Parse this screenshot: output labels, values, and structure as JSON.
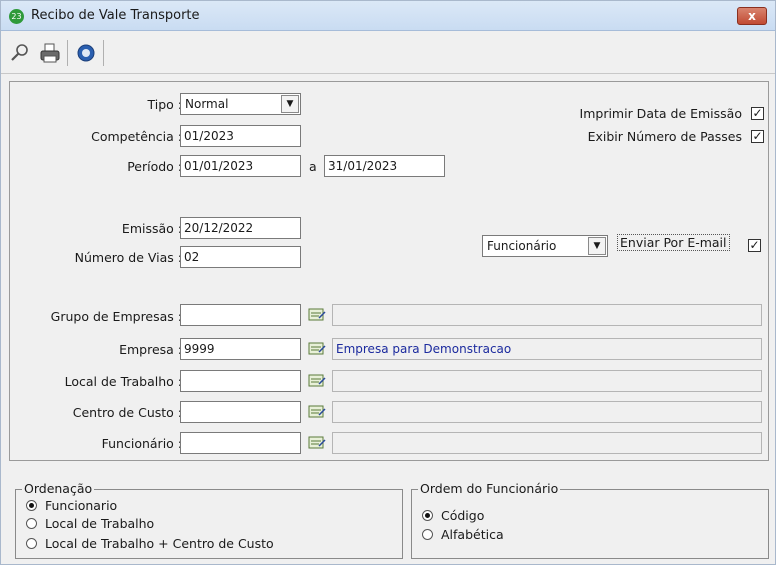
{
  "window": {
    "title": "Recibo de Vale Transporte",
    "app_icon_text": "23",
    "close_label": "x"
  },
  "toolbar": {
    "icons": [
      "search-icon",
      "printer-icon",
      "info-icon"
    ]
  },
  "form": {
    "tipo": {
      "label": "Tipo :",
      "value": "Normal"
    },
    "competencia": {
      "label": "Competência :",
      "value": "01/2023"
    },
    "periodo": {
      "label": "Período :",
      "from": "01/01/2023",
      "sep": "a",
      "to": "31/01/2023"
    },
    "emissao": {
      "label": "Emissão :",
      "value": "20/12/2022"
    },
    "numero_vias": {
      "label": "Número de Vias :",
      "value": "02"
    },
    "imprimir_data": {
      "label": "Imprimir Data de Emissão",
      "checked": true
    },
    "exibir_numero": {
      "label": "Exibir Número de Passes",
      "checked": true
    },
    "envio_por": {
      "value": "Funcionário"
    },
    "enviar_email": {
      "label": "Enviar Por E-mail",
      "checked": true
    },
    "grupo_empresas": {
      "label": "Grupo de Empresas :",
      "code": "",
      "desc": ""
    },
    "empresa": {
      "label": "Empresa :",
      "code": "9999",
      "desc": "Empresa para Demonstracao"
    },
    "local_trabalho": {
      "label": "Local de Trabalho :",
      "code": "",
      "desc": ""
    },
    "centro_custo": {
      "label": "Centro de Custo :",
      "code": "",
      "desc": ""
    },
    "funcionario": {
      "label": "Funcionário :",
      "code": "",
      "desc": ""
    }
  },
  "ordenacao": {
    "title": "Ordenação",
    "options": [
      "Funcionario",
      "Local de Trabalho",
      "Local de Trabalho + Centro de Custo"
    ],
    "selected": 0
  },
  "ordem_funcionario": {
    "title": "Ordem do Funcionário",
    "options": [
      "Código",
      "Alfabética"
    ],
    "selected": 0
  },
  "check_mark": "✓",
  "dropdown_arrow": "▼"
}
